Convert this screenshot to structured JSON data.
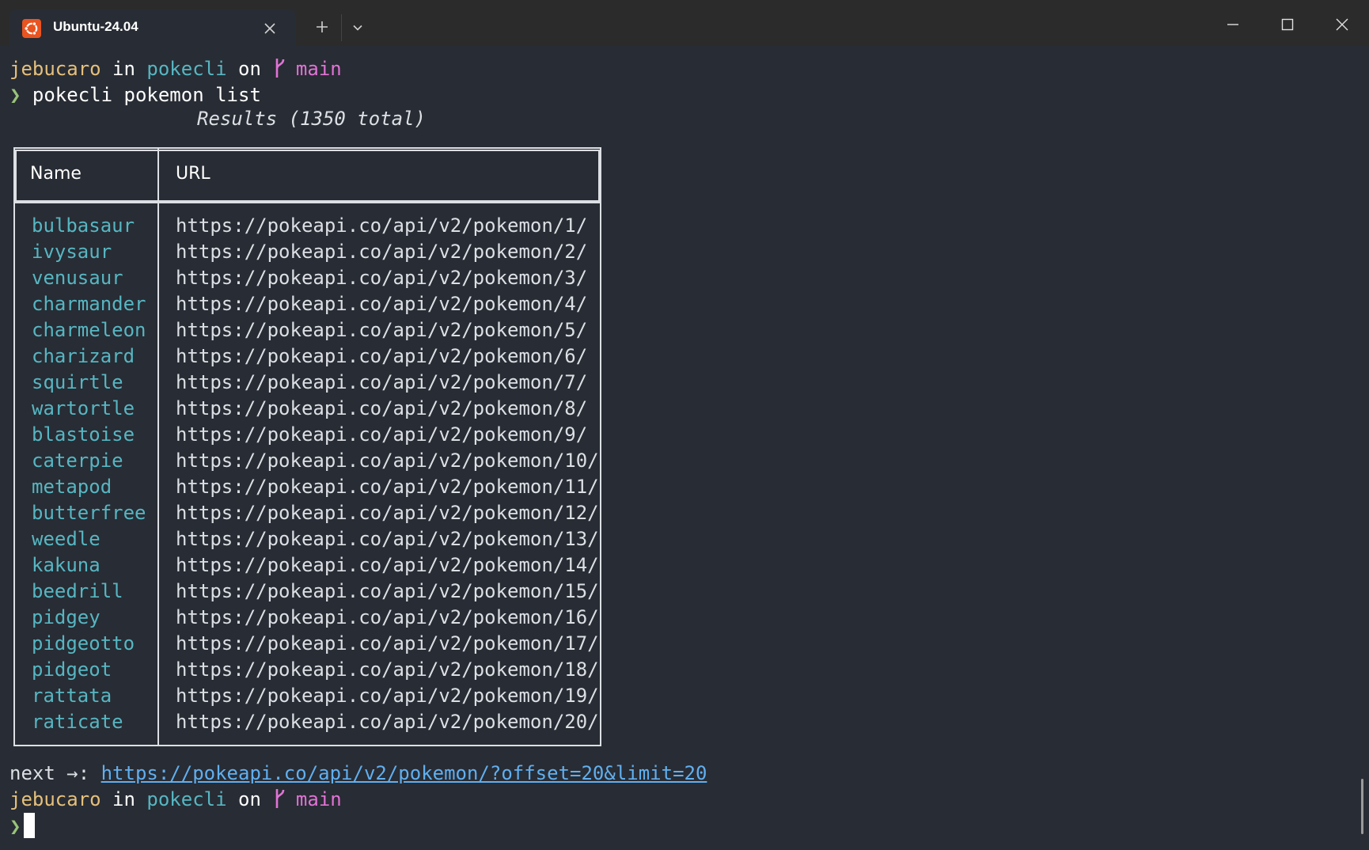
{
  "window": {
    "tab_title": "Ubuntu-24.04",
    "tab_icon": "ubuntu-logo-icon",
    "accent": "#e95420"
  },
  "prompt1": {
    "user": "jebucaro",
    "in": "in",
    "dir": "pokecli",
    "on": "on",
    "branch": "main"
  },
  "command": {
    "chevron": "❯",
    "text": "pokecli pokemon list"
  },
  "table": {
    "title": "Results (1350 total)",
    "headers": [
      "Name",
      "URL"
    ],
    "rows": [
      {
        "name": "bulbasaur",
        "url": "https://pokeapi.co/api/v2/pokemon/1/"
      },
      {
        "name": "ivysaur",
        "url": "https://pokeapi.co/api/v2/pokemon/2/"
      },
      {
        "name": "venusaur",
        "url": "https://pokeapi.co/api/v2/pokemon/3/"
      },
      {
        "name": "charmander",
        "url": "https://pokeapi.co/api/v2/pokemon/4/"
      },
      {
        "name": "charmeleon",
        "url": "https://pokeapi.co/api/v2/pokemon/5/"
      },
      {
        "name": "charizard",
        "url": "https://pokeapi.co/api/v2/pokemon/6/"
      },
      {
        "name": "squirtle",
        "url": "https://pokeapi.co/api/v2/pokemon/7/"
      },
      {
        "name": "wartortle",
        "url": "https://pokeapi.co/api/v2/pokemon/8/"
      },
      {
        "name": "blastoise",
        "url": "https://pokeapi.co/api/v2/pokemon/9/"
      },
      {
        "name": "caterpie",
        "url": "https://pokeapi.co/api/v2/pokemon/10/"
      },
      {
        "name": "metapod",
        "url": "https://pokeapi.co/api/v2/pokemon/11/"
      },
      {
        "name": "butterfree",
        "url": "https://pokeapi.co/api/v2/pokemon/12/"
      },
      {
        "name": "weedle",
        "url": "https://pokeapi.co/api/v2/pokemon/13/"
      },
      {
        "name": "kakuna",
        "url": "https://pokeapi.co/api/v2/pokemon/14/"
      },
      {
        "name": "beedrill",
        "url": "https://pokeapi.co/api/v2/pokemon/15/"
      },
      {
        "name": "pidgey",
        "url": "https://pokeapi.co/api/v2/pokemon/16/"
      },
      {
        "name": "pidgeotto",
        "url": "https://pokeapi.co/api/v2/pokemon/17/"
      },
      {
        "name": "pidgeot",
        "url": "https://pokeapi.co/api/v2/pokemon/18/"
      },
      {
        "name": "rattata",
        "url": "https://pokeapi.co/api/v2/pokemon/19/"
      },
      {
        "name": "raticate",
        "url": "https://pokeapi.co/api/v2/pokemon/20/"
      }
    ]
  },
  "next": {
    "label": "next →:",
    "url": "https://pokeapi.co/api/v2/pokemon/?offset=20&limit=20"
  },
  "prompt2": {
    "user": "jebucaro",
    "in": "in",
    "dir": "pokecli",
    "on": "on",
    "branch": "main",
    "chevron": "❯"
  },
  "colors": {
    "background": "#282c34",
    "user": "#e5c07b",
    "dir": "#56b6c2",
    "branch": "#e173d6",
    "chevron": "#98c379",
    "link": "#61afef"
  }
}
